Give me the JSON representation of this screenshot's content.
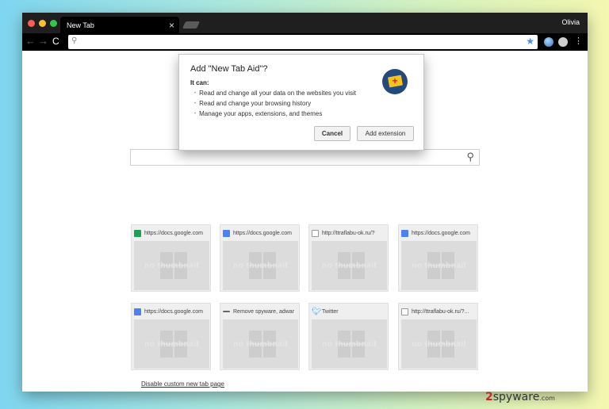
{
  "browser": {
    "tab_title": "New Tab",
    "tab_close": "×",
    "user_name": "Olivia",
    "nav": {
      "back": "←",
      "forward": "→",
      "reload": "C"
    },
    "omnibox_value": "",
    "menu_glyph": "⋮"
  },
  "dialog": {
    "title": "Add \"New Tab Aid\"?",
    "it_can": "It can:",
    "permissions": [
      "Read and change all your data on the websites you visit",
      "Read and change your browsing history",
      "Manage your apps, extensions, and themes"
    ],
    "cancel_label": "Cancel",
    "add_label": "Add extension",
    "icon_glyph": "+"
  },
  "search": {
    "value": ""
  },
  "tiles": [
    {
      "url": "https://docs.google.com",
      "favicon": "sheet",
      "thumb_text": "no thumbnail"
    },
    {
      "url": "https://docs.google.com",
      "favicon": "doc",
      "thumb_text": "no thumbnail"
    },
    {
      "url": "http://ttraflabu-ok.ru/?",
      "favicon": "page",
      "thumb_text": "no thumbnail"
    },
    {
      "url": "https://docs.google.com",
      "favicon": "doc",
      "thumb_text": "no thumbnail"
    },
    {
      "url": "https://docs.google.com",
      "favicon": "doc",
      "thumb_text": "no thumbnail"
    },
    {
      "url": "Remove spyware, adwar",
      "favicon": "dash",
      "thumb_text": "no thumbnail"
    },
    {
      "url": "Twitter",
      "favicon": "bird",
      "thumb_text": "no thumbnail"
    },
    {
      "url": "http://ttraflabu-ok.ru/?...",
      "favicon": "page",
      "thumb_text": "no thumbnail"
    }
  ],
  "footer": {
    "disable_link": "Disable custom new tab page"
  },
  "watermark": {
    "prefix": "2",
    "main": "spyware",
    "suffix": ".com"
  },
  "colors": {
    "accent": "#4a8af4",
    "title_bar": "#1f1f1f",
    "toolbar": "#000000"
  }
}
